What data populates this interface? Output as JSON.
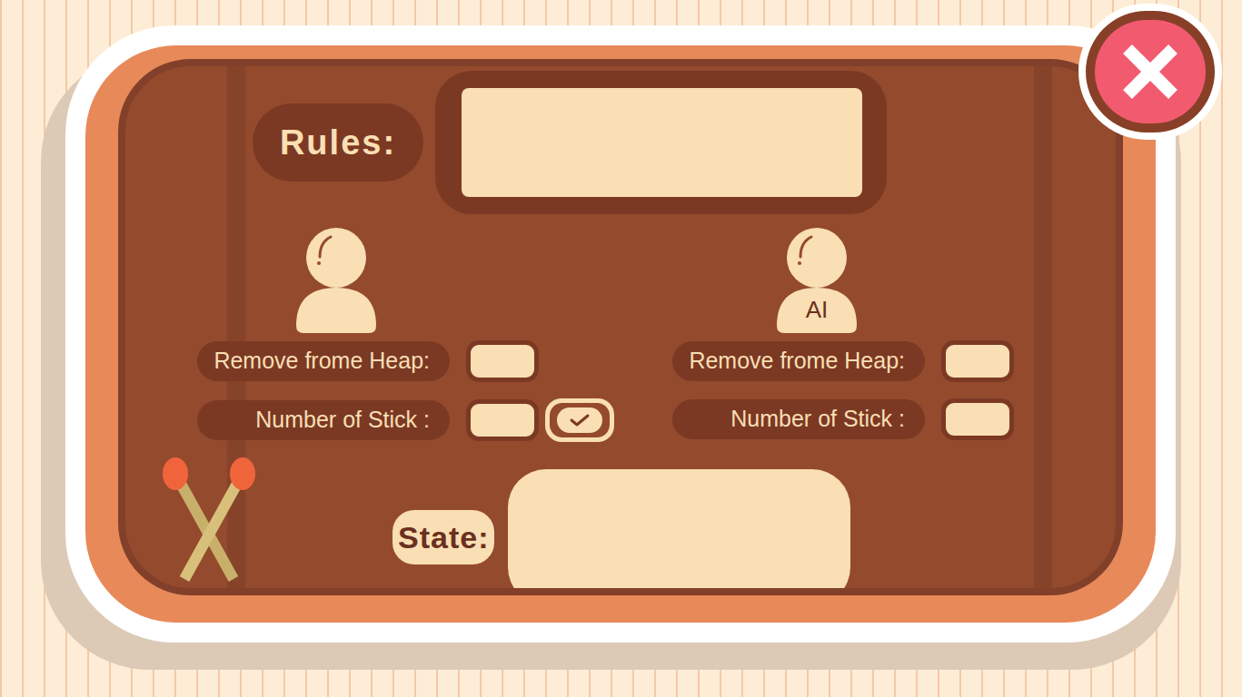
{
  "rules": {
    "label": "Rules:",
    "value": ""
  },
  "players": [
    {
      "kind": "human",
      "badge": "",
      "confirm": true,
      "fields": [
        {
          "label": "Remove frome Heap:",
          "value": ""
        },
        {
          "label": "Number of Stick :",
          "value": ""
        }
      ]
    },
    {
      "kind": "ai",
      "badge": "AI",
      "confirm": false,
      "fields": [
        {
          "label": "Remove frome Heap:",
          "value": ""
        },
        {
          "label": "Number of Stick :",
          "value": ""
        }
      ]
    }
  ],
  "state": {
    "label": "State:",
    "value": ""
  }
}
